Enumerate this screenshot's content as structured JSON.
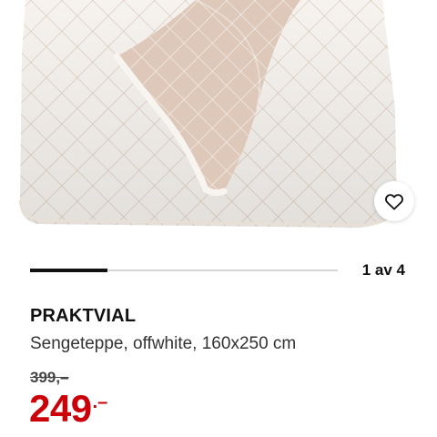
{
  "product": {
    "image_alt": "bedspread product photo",
    "name": "PRAKTVIAL",
    "description": "Sengeteppe, offwhite, 160x250 cm",
    "old_price": "399,–",
    "price_integer": "249",
    "price_suffix": ".–"
  },
  "carousel": {
    "indicator": "1 av 4",
    "current": 1,
    "total": 4
  },
  "icons": {
    "favorite": "heart-icon"
  },
  "colors": {
    "price_red": "#cc0008",
    "text_dark": "#111111",
    "track_gray": "#d6d6d6",
    "fabric_offwhite": "#f5f2ee",
    "fabric_reverse": "#dcc6b8"
  }
}
